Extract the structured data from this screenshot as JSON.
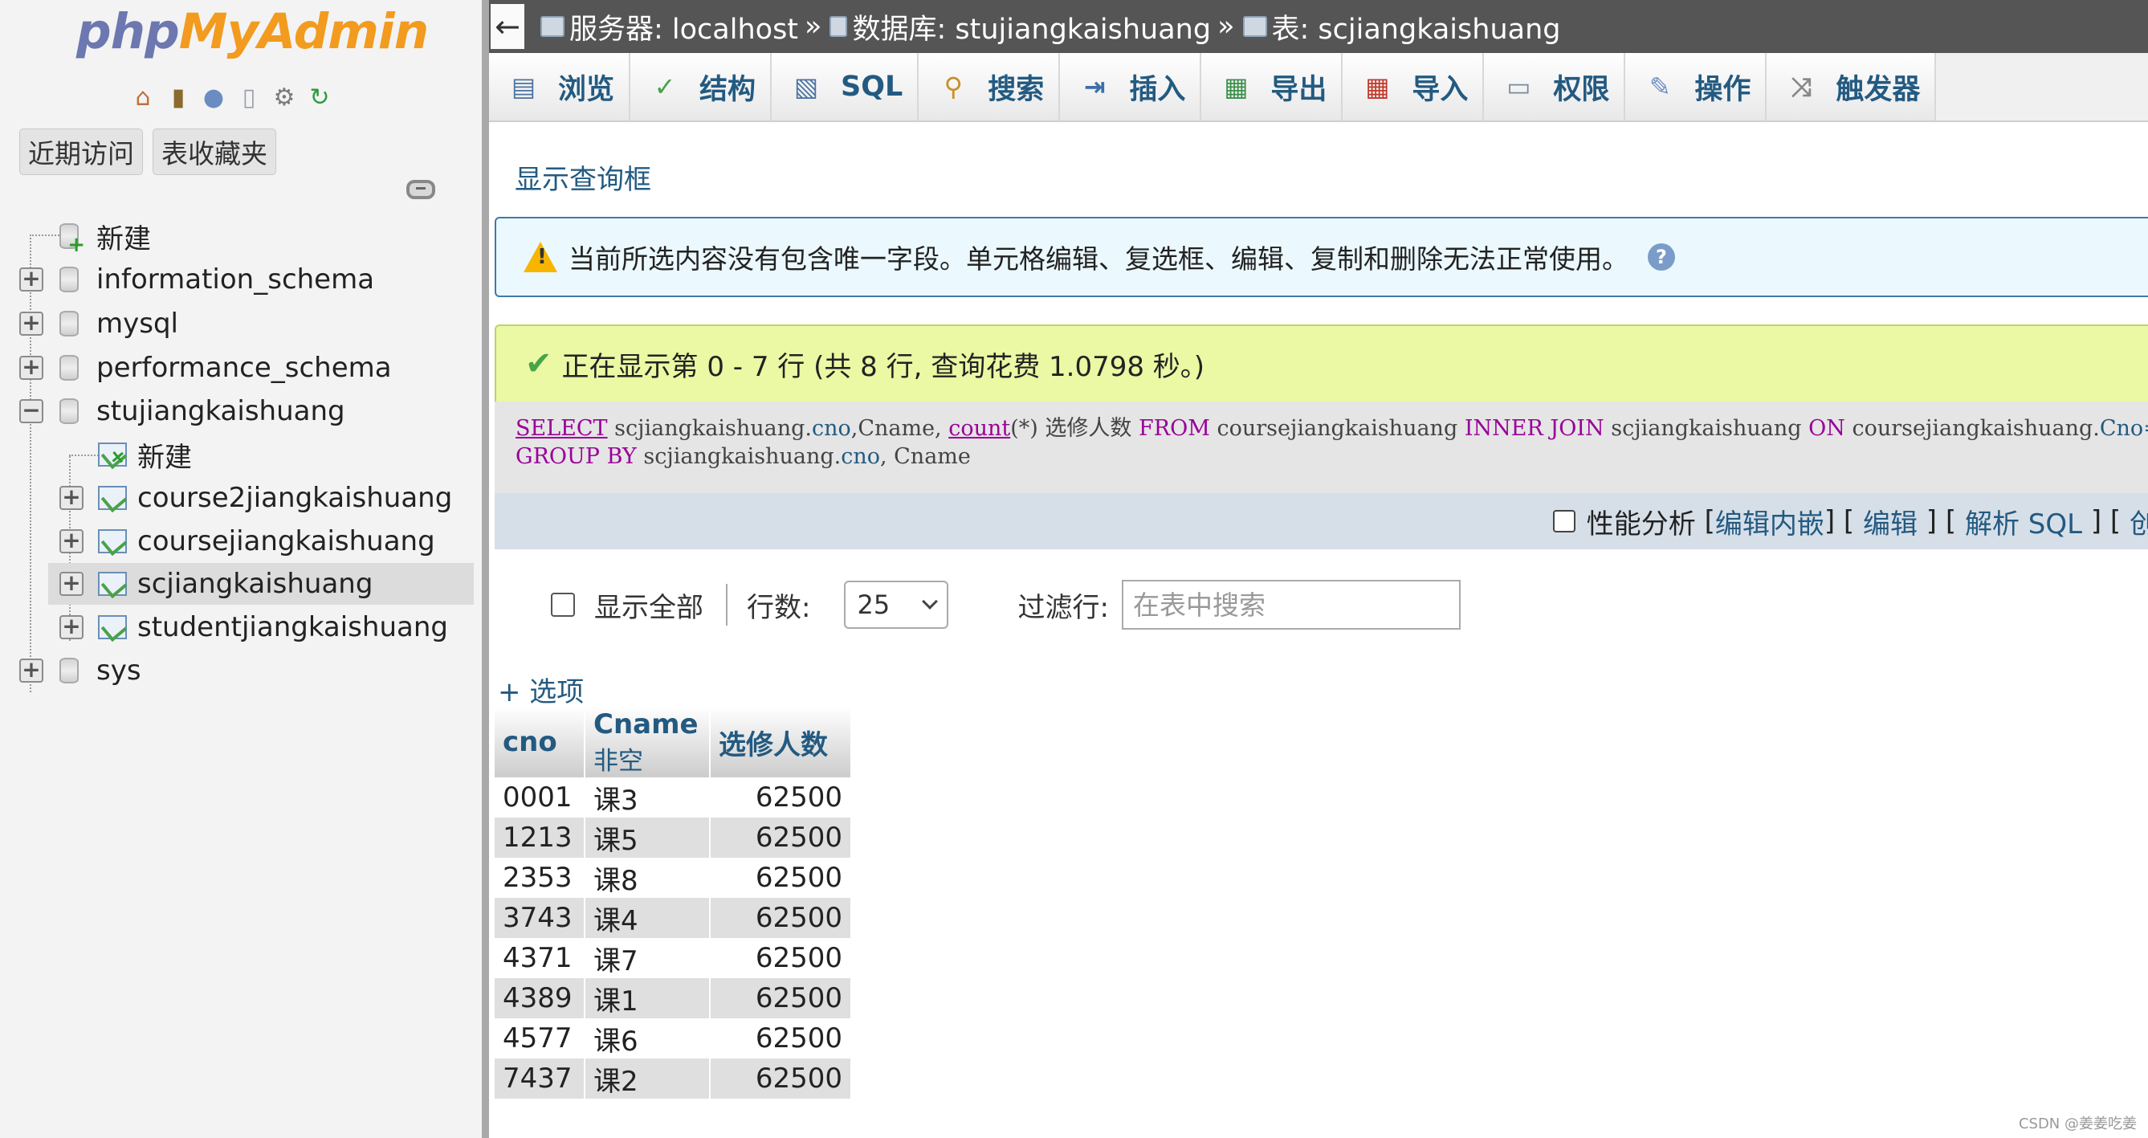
{
  "nav": {
    "logo_php": "php",
    "logo_myadmin": "MyAdmin",
    "tabs": [
      "近期访问",
      "表收藏夹"
    ],
    "tree": {
      "new": "新建",
      "databases": [
        "information_schema",
        "mysql",
        "performance_schema",
        "stujiangkaishuang",
        "sys"
      ],
      "sub_new": "新建",
      "tables": [
        "course2jiangkaishuang",
        "coursejiangkaishuang",
        "scjiangkaishuang",
        "studentjiangkaishuang"
      ]
    }
  },
  "breadcrumb": {
    "server": "服务器: localhost",
    "database": "数据库: stujiangkaishuang",
    "table": "表: scjiangkaishuang"
  },
  "menu": [
    {
      "label": "浏览",
      "icon": "browse-icon"
    },
    {
      "label": "结构",
      "icon": "structure-icon"
    },
    {
      "label": "SQL",
      "icon": "sql-icon"
    },
    {
      "label": "搜索",
      "icon": "search-icon"
    },
    {
      "label": "插入",
      "icon": "insert-icon"
    },
    {
      "label": "导出",
      "icon": "export-icon"
    },
    {
      "label": "导入",
      "icon": "import-icon"
    },
    {
      "label": "权限",
      "icon": "privileges-icon"
    },
    {
      "label": "操作",
      "icon": "operations-icon"
    },
    {
      "label": "触发器",
      "icon": "triggers-icon"
    }
  ],
  "show_query_box": "显示查询框",
  "notice_text": "当前所选内容没有包含唯一字段。单元格编辑、复选框、编辑、复制和删除无法正常使用。",
  "success_text": "正在显示第 0 - 7 行 (共 8 行, 查询花费 1.0798 秒。)",
  "sql": {
    "select": "SELECT",
    "t1": "scjiangkaishuang.",
    "cno": "cno",
    "cname_part": ",Cname,",
    "count": "count",
    "count_rest": "(*) 选修人数",
    "from": "FROM",
    "from_tbl": "coursejiangkaishuang",
    "inner": "INNER",
    "join": "JOIN",
    "join_tbl": "scjiangkaishuang",
    "on": "ON",
    "on_tbl": "coursejiangkaishuang.",
    "on_col": "Cno=s",
    "group": "GROUP",
    "by": "BY",
    "g_tbl": "scjiangkaishuang.",
    "g_col": "cno",
    "g_rest": ", Cname"
  },
  "actions": {
    "profiling": "性能分析",
    "edit_inline": "编辑内嵌",
    "edit": "编辑",
    "explain": "解析 SQL",
    "create_prefix": "创"
  },
  "controls": {
    "show_all": "显示全部",
    "rows_label": "行数:",
    "rows_value": "25",
    "filter_label": "过滤行:",
    "filter_placeholder": "在表中搜索"
  },
  "options_link": "+ 选项",
  "table": {
    "headers": {
      "cno": "cno",
      "cname": "Cname",
      "cname_sub": "非空",
      "count": "选修人数"
    },
    "rows": [
      [
        "0001",
        "课3",
        "62500"
      ],
      [
        "1213",
        "课5",
        "62500"
      ],
      [
        "2353",
        "课8",
        "62500"
      ],
      [
        "3743",
        "课4",
        "62500"
      ],
      [
        "4371",
        "课7",
        "62500"
      ],
      [
        "4389",
        "课1",
        "62500"
      ],
      [
        "4577",
        "课6",
        "62500"
      ],
      [
        "7437",
        "课2",
        "62500"
      ]
    ]
  },
  "watermark": "CSDN @姜姜吃姜"
}
